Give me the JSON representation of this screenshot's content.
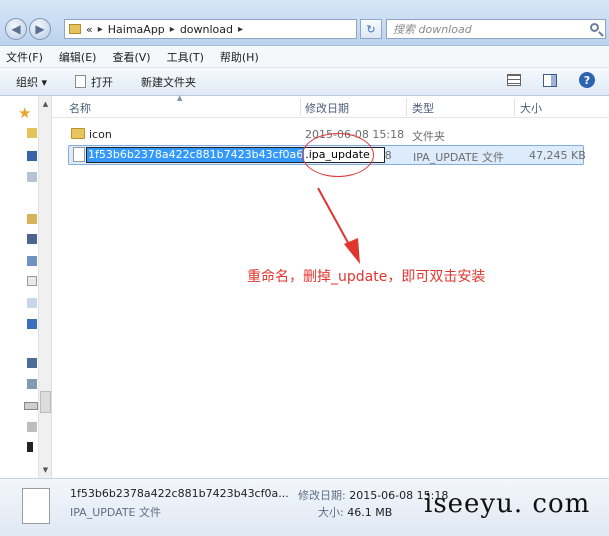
{
  "address": {
    "crumb_prefix": "«",
    "crumbs": [
      "HaimaApp",
      "download"
    ],
    "search_placeholder": "搜索 download"
  },
  "menu": [
    "文件(F)",
    "编辑(E)",
    "查看(V)",
    "工具(T)",
    "帮助(H)"
  ],
  "commands": {
    "organize": "组织 ▾",
    "open": "打开",
    "new_folder": "新建文件夹"
  },
  "columns": {
    "name": "名称",
    "modified": "修改日期",
    "type": "类型",
    "size": "大小"
  },
  "files": [
    {
      "name": "icon",
      "modified": "2015-06-08 15:18",
      "type": "文件夹",
      "size": ""
    },
    {
      "name_selected": "1f53b6b2378a422c881b7423b43cf0a6",
      "name_rest": ".ipa_update",
      "modified": "15:18",
      "type": "IPA_UPDATE 文件",
      "size": "47,245 KB"
    }
  ],
  "annotation": "重命名，删掉_update，即可双击安装",
  "details": {
    "name": "1f53b6b2378a422c881b7423b43cf0a...",
    "type": "IPA_UPDATE 文件",
    "modified_label": "修改日期:",
    "modified_value": "2015-06-08 15:18",
    "size_label": "大小:",
    "size_value": "46.1 MB"
  },
  "watermark": "iseeyu. com",
  "colors": {
    "annotation": "#e0362f",
    "selection": "#3399ff"
  }
}
